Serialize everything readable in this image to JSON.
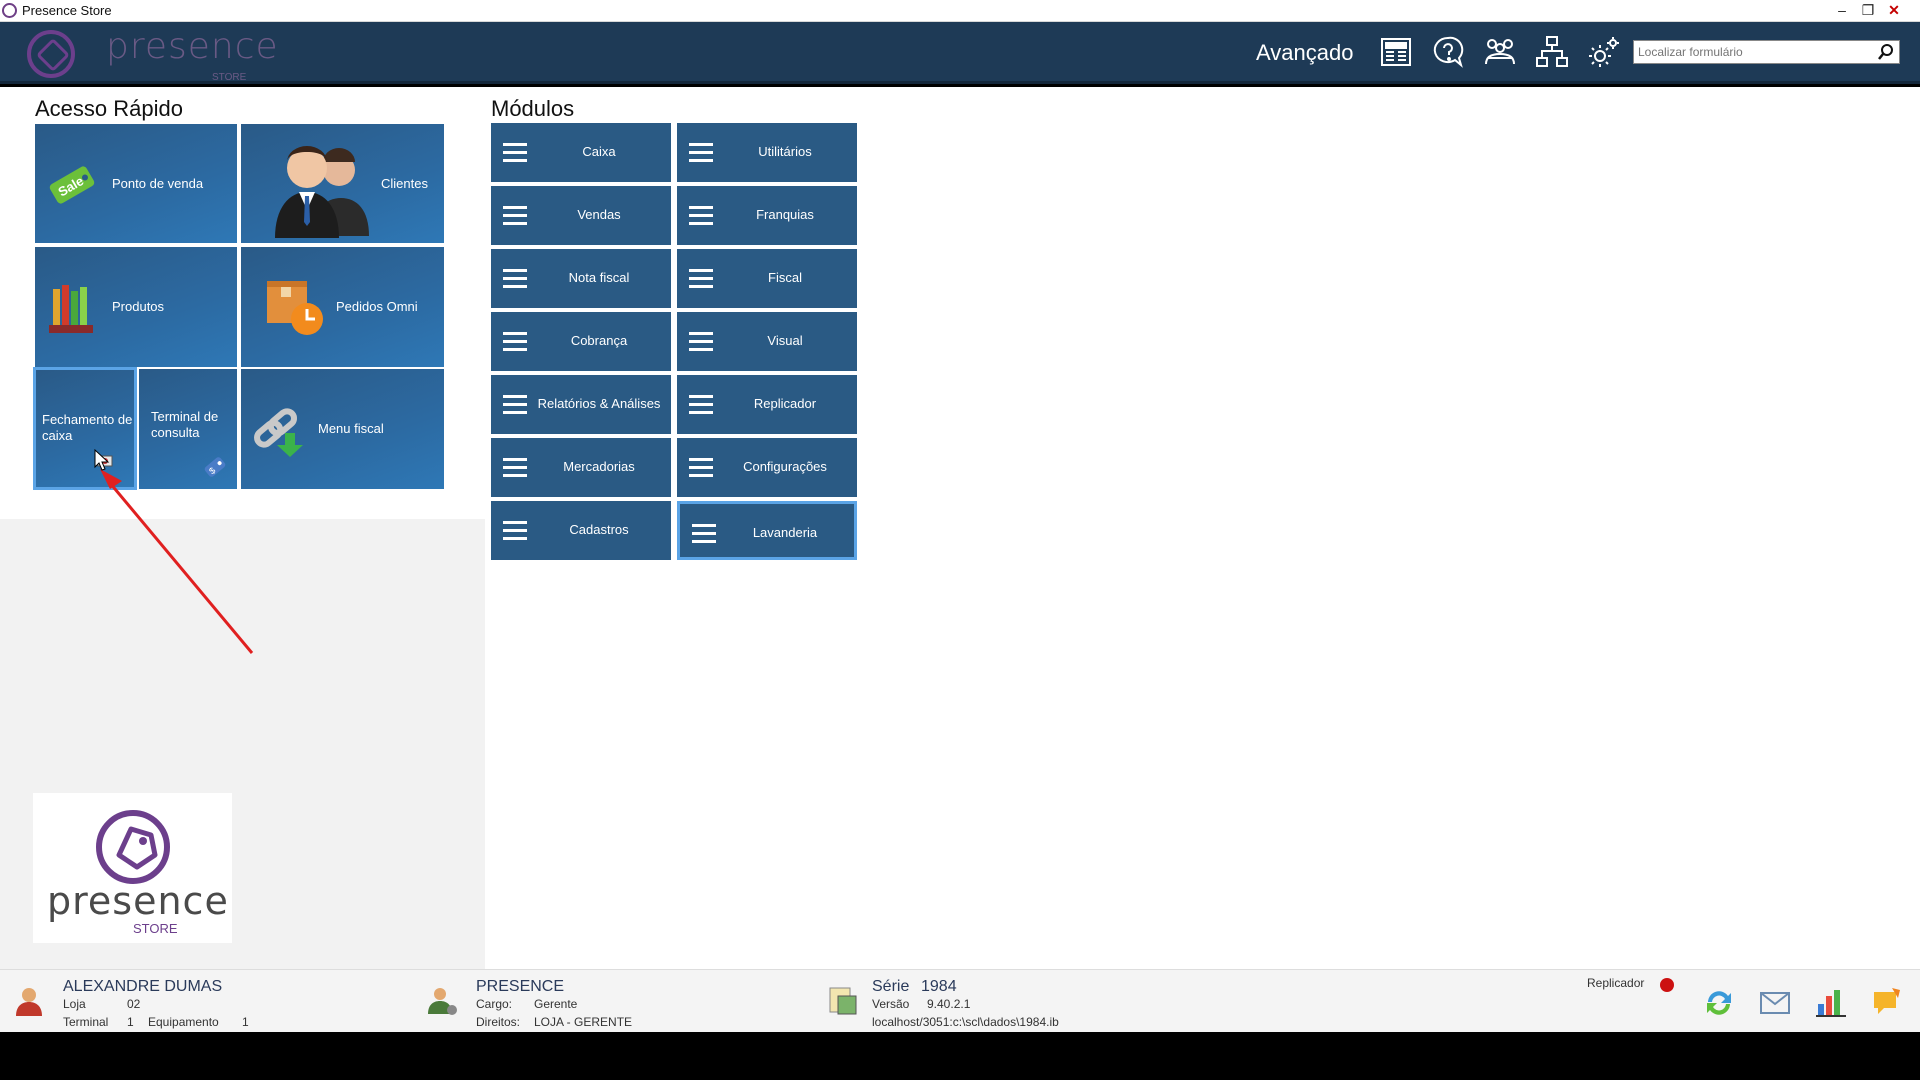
{
  "window": {
    "title": "Presence Store",
    "min": "–",
    "restore": "❐",
    "close": "✕"
  },
  "header": {
    "logo_text": "presence",
    "logo_sub": "STORE",
    "advanced_label": "Avançado",
    "icons": [
      "news-icon",
      "help-icon",
      "users-icon",
      "network-icon",
      "settings-icon"
    ],
    "search_placeholder": "Localizar formulário"
  },
  "quick_access": {
    "title": "Acesso Rápido",
    "tiles": [
      {
        "label": "Ponto de venda",
        "icon": "sale-tag-icon"
      },
      {
        "label": "Clientes",
        "icon": "people-icon"
      },
      {
        "label": "Produtos",
        "icon": "products-icon"
      },
      {
        "label": "Pedidos Omni",
        "icon": "box-clock-icon"
      },
      {
        "label": "Fechamento de caixa",
        "icon": "cash-close-icon"
      },
      {
        "label": "Terminal de consulta",
        "icon": "price-tag-icon"
      },
      {
        "label": "Menu fiscal",
        "icon": "chain-download-icon"
      }
    ]
  },
  "modules": {
    "title": "Módulos",
    "items": [
      "Caixa",
      "Utilitários",
      "Vendas",
      "Franquias",
      "Nota fiscal",
      "Fiscal",
      "Cobrança",
      "Visual",
      "Relatórios & Análises",
      "Replicador",
      "Mercadorias",
      "Configurações",
      "Cadastros",
      "Lavanderia"
    ]
  },
  "brand": {
    "text": "presence",
    "sub": "STORE"
  },
  "status": {
    "user_name": "ALEXANDRE DUMAS",
    "loja_label": "Loja",
    "loja_value": "02",
    "terminal_label": "Terminal",
    "terminal_value": "1",
    "equip_label": "Equipamento",
    "equip_value": "1",
    "company": "PRESENCE",
    "cargo_label": "Cargo:",
    "cargo_value": "Gerente",
    "direitos_label": "Direitos:",
    "direitos_value": "LOJA - GERENTE",
    "serie_label": "Série",
    "serie_value": "1984",
    "versao_label": "Versão",
    "versao_value": "9.40.2.1",
    "db_path": "localhost/3051:c:\\scl\\dados\\1984.ib",
    "replicador_label": "Replicador",
    "replicador_status_color": "#cc1111"
  },
  "colors": {
    "header_bg": "#1e3a56",
    "tile_bg": "#2a5a84",
    "accent_purple": "#6c3f8c",
    "arrow": "#e02020"
  }
}
